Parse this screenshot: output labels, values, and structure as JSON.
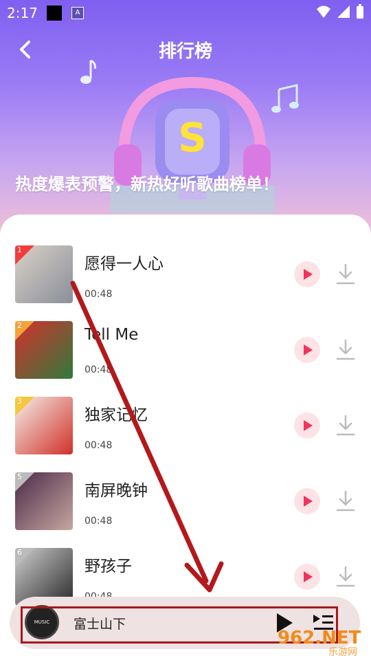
{
  "status_bar": {
    "time": "2:17"
  },
  "header": {
    "title": "排行榜",
    "slogan": "热度爆表预警，新热好听歌曲榜单！"
  },
  "songs": [
    {
      "rank": "1",
      "title": "愿得一人心",
      "duration": "00:48",
      "badge_color": "#f23c3c",
      "cover_colors": [
        "#d9d0c6",
        "#8a8f9a"
      ]
    },
    {
      "rank": "2",
      "title": "Tell Me",
      "duration": "00:48",
      "badge_color": "#f3a33a",
      "cover_colors": [
        "#d6302c",
        "#2f7a3d"
      ]
    },
    {
      "rank": "3",
      "title": "独家记忆",
      "duration": "00:48",
      "badge_color": "#f7c73a",
      "cover_colors": [
        "#f4f0ea",
        "#d03028"
      ]
    },
    {
      "rank": "5",
      "title": "南屏晚钟",
      "duration": "00:48",
      "badge_color": "#bbbbbb",
      "cover_colors": [
        "#4a2a4a",
        "#c7a6a0"
      ]
    },
    {
      "rank": "6",
      "title": "野孩子",
      "duration": "00:48",
      "badge_color": "#bbbbbb",
      "cover_colors": [
        "#cfcfcf",
        "#2a2a2a"
      ]
    }
  ],
  "player": {
    "current_title": "富士山下",
    "cover_text": "MUSIC"
  },
  "watermark": {
    "brand": "962.NET",
    "sub": "乐游网"
  },
  "colors": {
    "accent": "#f2345a",
    "annotation": "#a8171a",
    "header_top": "#7f5ff0"
  }
}
